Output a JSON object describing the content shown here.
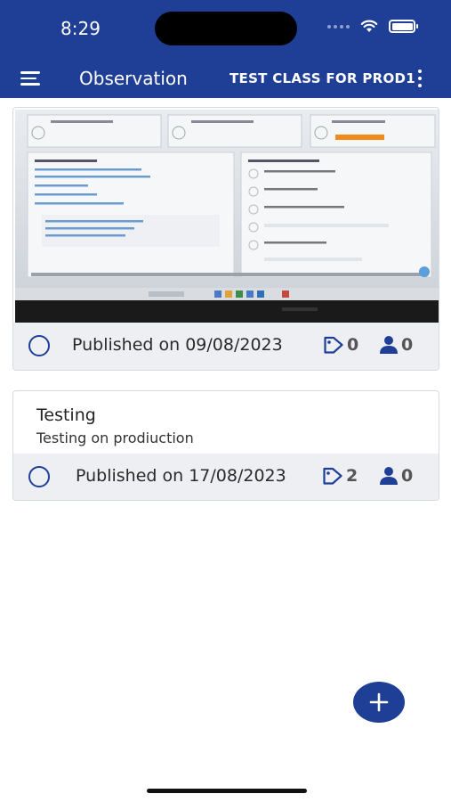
{
  "status_bar": {
    "time": "8:29"
  },
  "header": {
    "title": "Observation",
    "class_name": "TEST CLASS FOR PROD1"
  },
  "observations": [
    {
      "photo_alt": "Photo of laptop screen",
      "published": "Published on 09/08/2023",
      "tags_count": "0",
      "students_count": "0"
    },
    {
      "title": "Testing",
      "description": "Testing on prodiuction",
      "published": "Published on 17/08/2023",
      "tags_count": "2",
      "students_count": "0"
    }
  ],
  "colors": {
    "brand": "#1f3f96",
    "footer_bg": "#eeeff3",
    "icon_gray": "#555555"
  },
  "icons": {
    "menu": "hamburger-icon",
    "more": "kebab-icon",
    "tag": "tag-icon",
    "user": "person-icon",
    "add": "plus-icon"
  }
}
